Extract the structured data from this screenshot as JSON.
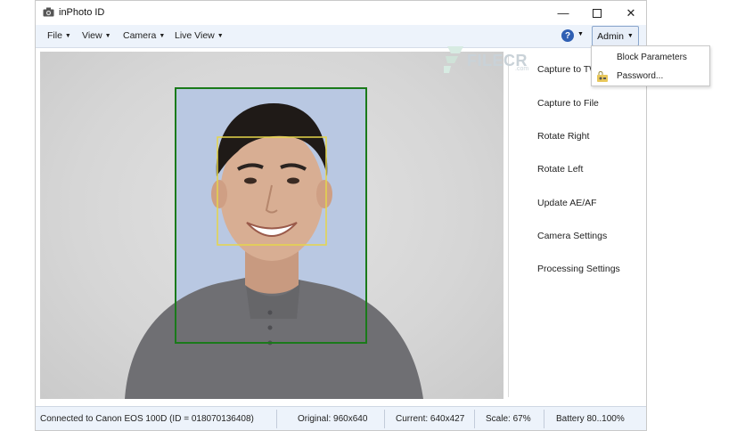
{
  "window": {
    "title": "inPhoto ID"
  },
  "menu": {
    "items": [
      {
        "label": "File"
      },
      {
        "label": "View"
      },
      {
        "label": "Camera"
      },
      {
        "label": "Live View"
      }
    ],
    "help_label": "?",
    "admin_label": "Admin"
  },
  "admin_menu": {
    "items": [
      {
        "label": "Block Parameters"
      },
      {
        "label": "Password..."
      }
    ]
  },
  "actions": [
    {
      "label": "Capture to TW"
    },
    {
      "label": "Capture to File"
    },
    {
      "label": "Rotate Right"
    },
    {
      "label": "Rotate Left"
    },
    {
      "label": "Update AE/AF"
    },
    {
      "label": "Camera Settings"
    },
    {
      "label": "Processing Settings"
    }
  ],
  "status": {
    "connection": "Connected to Canon EOS 100D (ID = 018070136408)",
    "original": "Original: 960x640",
    "current": "Current: 640x427",
    "scale": "Scale: 67%",
    "battery": "Battery 80..100%"
  },
  "watermark": {
    "brand": "FILECR",
    "suffix": ".com"
  },
  "colors": {
    "face_frame": "#1a7a1a",
    "face_detect_box": "#e6d64a",
    "menubar_bg": "#edf3fb",
    "admin_button_border": "#8aa6cc",
    "help_icon": "#2f5fb3"
  },
  "icons": {
    "app": "camera-icon",
    "help": "help-circle-icon",
    "password": "key-lock-icon"
  }
}
